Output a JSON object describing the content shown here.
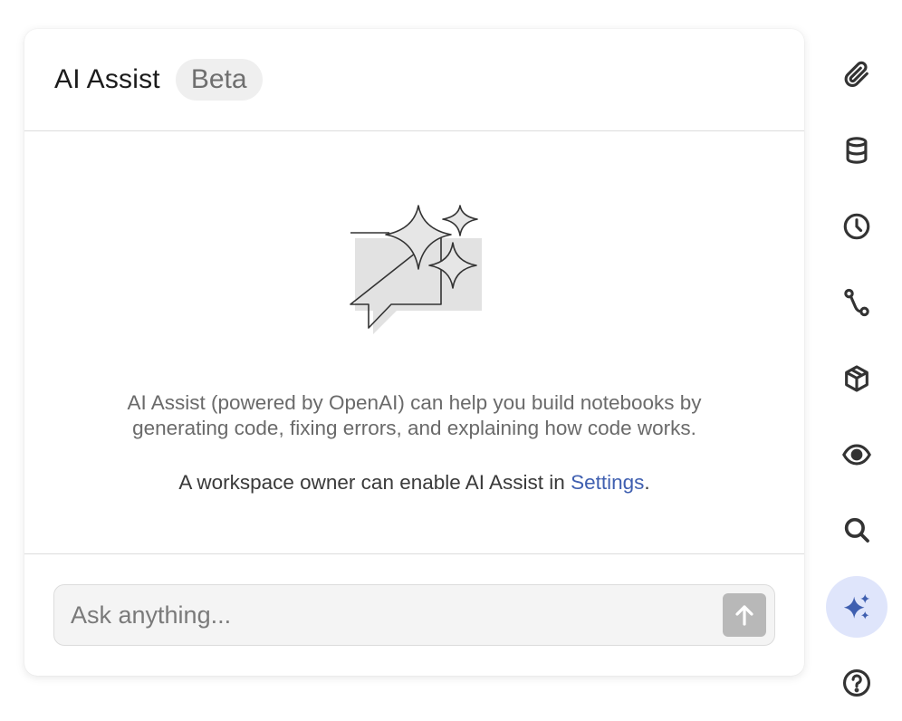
{
  "header": {
    "title": "AI Assist",
    "badge": "Beta"
  },
  "body": {
    "description_line1": "AI Assist (powered by OpenAI) can help you build notebooks by",
    "description_line2": "generating code, fixing errors, and explaining how code works.",
    "enable_prefix": "A workspace owner can enable AI Assist in ",
    "settings_link": "Settings",
    "enable_suffix": "."
  },
  "input": {
    "placeholder": "Ask anything..."
  },
  "rail": {
    "items": [
      {
        "icon": "paperclip-icon"
      },
      {
        "icon": "database-icon"
      },
      {
        "icon": "clock-icon"
      },
      {
        "icon": "path-icon"
      },
      {
        "icon": "package-icon"
      },
      {
        "icon": "eye-icon"
      },
      {
        "icon": "search-icon"
      },
      {
        "icon": "sparkles-icon",
        "active": true
      },
      {
        "icon": "help-icon"
      }
    ]
  },
  "colors": {
    "accent": "#3f5fb0",
    "active_rail_bg": "#dfe5fb",
    "send_button": "#b8b8b8"
  }
}
